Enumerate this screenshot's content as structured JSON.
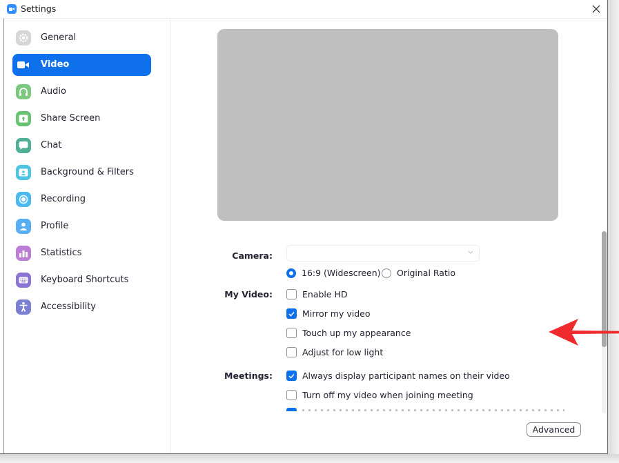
{
  "window": {
    "title": "Settings",
    "app_icon": "zoom-camera-icon",
    "close_icon": "close-icon"
  },
  "sidebar": {
    "active_index": 1,
    "items": [
      {
        "label": "General",
        "icon": "gear-icon",
        "color": "#d0d0d0"
      },
      {
        "label": "Video",
        "icon": "video-camera-icon",
        "color": "#0e71eb"
      },
      {
        "label": "Audio",
        "icon": "headphones-icon",
        "color": "#7cc87f"
      },
      {
        "label": "Share Screen",
        "icon": "share-screen-icon",
        "color": "#68c26f"
      },
      {
        "label": "Chat",
        "icon": "chat-bubble-icon",
        "color": "#4fae95"
      },
      {
        "label": "Background & Filters",
        "icon": "background-person-icon",
        "color": "#4cc4e2"
      },
      {
        "label": "Recording",
        "icon": "record-icon",
        "color": "#4bb9f0"
      },
      {
        "label": "Profile",
        "icon": "profile-icon",
        "color": "#58aef2"
      },
      {
        "label": "Statistics",
        "icon": "bar-chart-icon",
        "color": "#bb7dd6"
      },
      {
        "label": "Keyboard Shortcuts",
        "icon": "keyboard-icon",
        "color": "#8b74d6"
      },
      {
        "label": "Accessibility",
        "icon": "accessibility-icon",
        "color": "#7a7fd1"
      }
    ]
  },
  "video": {
    "camera_label": "Camera:",
    "camera_value": "",
    "aspect": {
      "options": [
        {
          "label": "16:9 (Widescreen)",
          "selected": true
        },
        {
          "label": "Original Ratio",
          "selected": false
        }
      ]
    },
    "my_video_label": "My Video:",
    "my_video_options": [
      {
        "label": "Enable HD",
        "checked": false
      },
      {
        "label": "Mirror my video",
        "checked": true
      },
      {
        "label": "Touch up my appearance",
        "checked": false
      },
      {
        "label": "Adjust for low light",
        "checked": false
      }
    ],
    "meetings_label": "Meetings:",
    "meetings_options": [
      {
        "label": "Always display participant names on their video",
        "checked": true
      },
      {
        "label": "Turn off my video when joining meeting",
        "checked": false
      },
      {
        "label": "",
        "checked": true
      }
    ],
    "advanced_button": "Advanced"
  },
  "annotation": {
    "arrow_color": "#ef2b2d",
    "points_to": "Mirror my video"
  },
  "colors": {
    "accent": "#0e71eb",
    "preview_bg": "#bfbfbf"
  }
}
